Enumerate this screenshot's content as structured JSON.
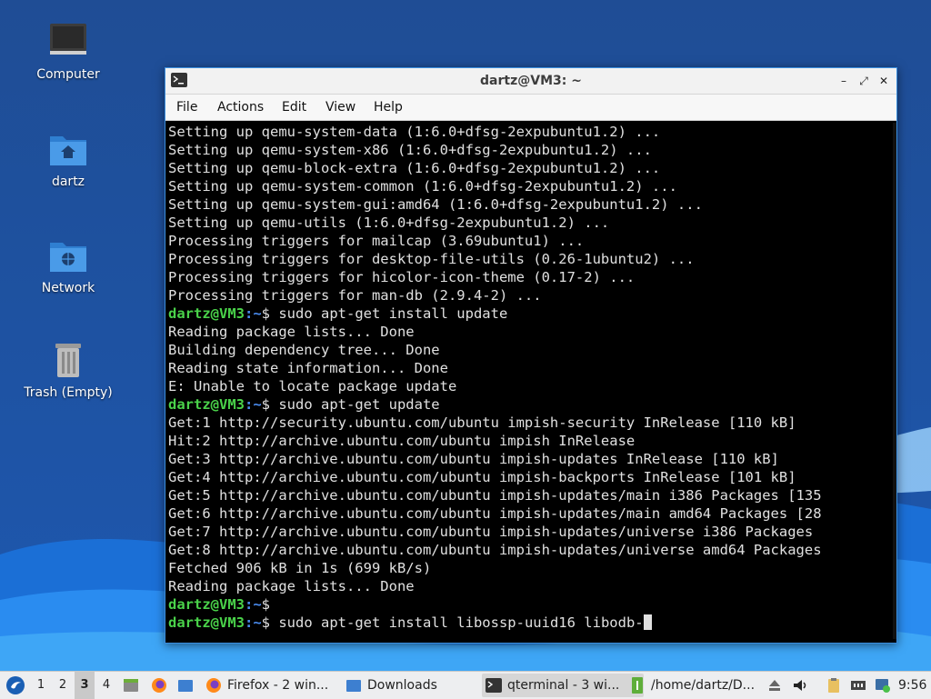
{
  "desktop": {
    "icons": [
      {
        "label": "Computer"
      },
      {
        "label": "dartz"
      },
      {
        "label": "Network"
      },
      {
        "label": "Trash (Empty)"
      }
    ]
  },
  "window": {
    "title": "dartz@VM3: ~",
    "controls": {
      "minimize": "–",
      "maximize": "⤢",
      "close": "✕"
    },
    "menu": [
      "File",
      "Actions",
      "Edit",
      "View",
      "Help"
    ]
  },
  "terminal": {
    "lines": [
      "Setting up qemu-system-data (1:6.0+dfsg-2expubuntu1.2) ...",
      "Setting up qemu-system-x86 (1:6.0+dfsg-2expubuntu1.2) ...",
      "Setting up qemu-block-extra (1:6.0+dfsg-2expubuntu1.2) ...",
      "Setting up qemu-system-common (1:6.0+dfsg-2expubuntu1.2) ...",
      "Setting up qemu-system-gui:amd64 (1:6.0+dfsg-2expubuntu1.2) ...",
      "Setting up qemu-utils (1:6.0+dfsg-2expubuntu1.2) ...",
      "Processing triggers for mailcap (3.69ubuntu1) ...",
      "Processing triggers for desktop-file-utils (0.26-1ubuntu2) ...",
      "Processing triggers for hicolor-icon-theme (0.17-2) ...",
      "Processing triggers for man-db (2.9.4-2) ...",
      {
        "user": "dartz@VM3",
        "path": ":~",
        "cmd": "$ sudo apt-get install update"
      },
      "Reading package lists... Done",
      "Building dependency tree... Done",
      "Reading state information... Done",
      "E: Unable to locate package update",
      {
        "user": "dartz@VM3",
        "path": ":~",
        "cmd": "$ sudo apt-get update"
      },
      "Get:1 http://security.ubuntu.com/ubuntu impish-security InRelease [110 kB]",
      "Hit:2 http://archive.ubuntu.com/ubuntu impish InRelease",
      "Get:3 http://archive.ubuntu.com/ubuntu impish-updates InRelease [110 kB]",
      "Get:4 http://archive.ubuntu.com/ubuntu impish-backports InRelease [101 kB]",
      "Get:5 http://archive.ubuntu.com/ubuntu impish-updates/main i386 Packages [135",
      "Get:6 http://archive.ubuntu.com/ubuntu impish-updates/main amd64 Packages [28",
      "Get:7 http://archive.ubuntu.com/ubuntu impish-updates/universe i386 Packages",
      "Get:8 http://archive.ubuntu.com/ubuntu impish-updates/universe amd64 Packages",
      "Fetched 906 kB in 1s (699 kB/s)",
      "Reading package lists... Done",
      {
        "user": "dartz@VM3",
        "path": ":~",
        "cmd": "$"
      },
      {
        "user": "dartz@VM3",
        "path": ":~",
        "cmd": "$ sudo apt-get install libossp-uuid16 libodb-",
        "cursor": true
      }
    ]
  },
  "taskbar": {
    "workspaces": [
      "1",
      "2",
      "3",
      "4"
    ],
    "active_workspace": "3",
    "tasks": [
      {
        "label": "Firefox - 2 win...",
        "icon": "firefox-icon",
        "active": false
      },
      {
        "label": "Downloads",
        "icon": "folder-icon",
        "active": false
      },
      {
        "label": "qterminal - 3 wi...",
        "icon": "terminal-icon",
        "active": true
      },
      {
        "label": "/home/dartz/D...",
        "icon": "text-editor-icon",
        "active": false
      }
    ],
    "clock": "9:56"
  },
  "colors": {
    "prompt_user": "#4ad24a",
    "prompt_path": "#4a8cf0",
    "window_border": "#3b8fe0",
    "wallpaper": "#1e4f9b"
  }
}
